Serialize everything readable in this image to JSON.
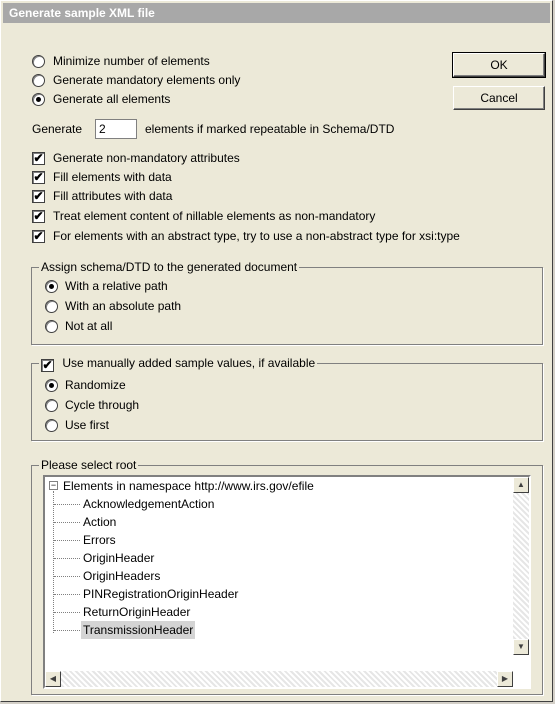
{
  "window": {
    "title": "Generate sample XML file"
  },
  "buttons": {
    "ok": "OK",
    "cancel": "Cancel"
  },
  "generation_mode": {
    "options": [
      "Minimize number of elements",
      "Generate mandatory elements only",
      "Generate all elements"
    ],
    "selected": "Generate all elements"
  },
  "repeat": {
    "prefix": "Generate",
    "value": "2",
    "suffix": "elements if marked repeatable in Schema/DTD"
  },
  "checkboxes": [
    {
      "label": "Generate non-mandatory attributes",
      "checked": true
    },
    {
      "label": "Fill elements with data",
      "checked": true
    },
    {
      "label": "Fill attributes with data",
      "checked": true
    },
    {
      "label": "Treat element content of nillable elements as non-mandatory",
      "checked": true
    },
    {
      "label": "For elements with an abstract type, try to use a non-abstract type for xsi:type",
      "checked": true
    }
  ],
  "assign_schema": {
    "legend": "Assign schema/DTD to the generated document",
    "options": [
      "With a relative path",
      "With an absolute path",
      "Not at all"
    ],
    "selected": "With a relative path"
  },
  "sample_values": {
    "legend": "Use manually added sample values, if available",
    "checked": true,
    "options": [
      "Randomize",
      "Cycle through",
      "Use first"
    ],
    "selected": "Randomize"
  },
  "root_select": {
    "legend": "Please select root",
    "namespace_node": "Elements in namespace http://www.irs.gov/efile",
    "items": [
      "AcknowledgementAction",
      "Action",
      "Errors",
      "OriginHeader",
      "OriginHeaders",
      "PINRegistrationOriginHeader",
      "ReturnOriginHeader",
      "TransmissionHeader"
    ],
    "selected": "TransmissionHeader"
  },
  "icons": {
    "collapse": "minus-box-icon",
    "scroll_up": "arrow-up-icon",
    "scroll_down": "arrow-down-icon",
    "scroll_left": "arrow-left-icon",
    "scroll_right": "arrow-right-icon"
  }
}
